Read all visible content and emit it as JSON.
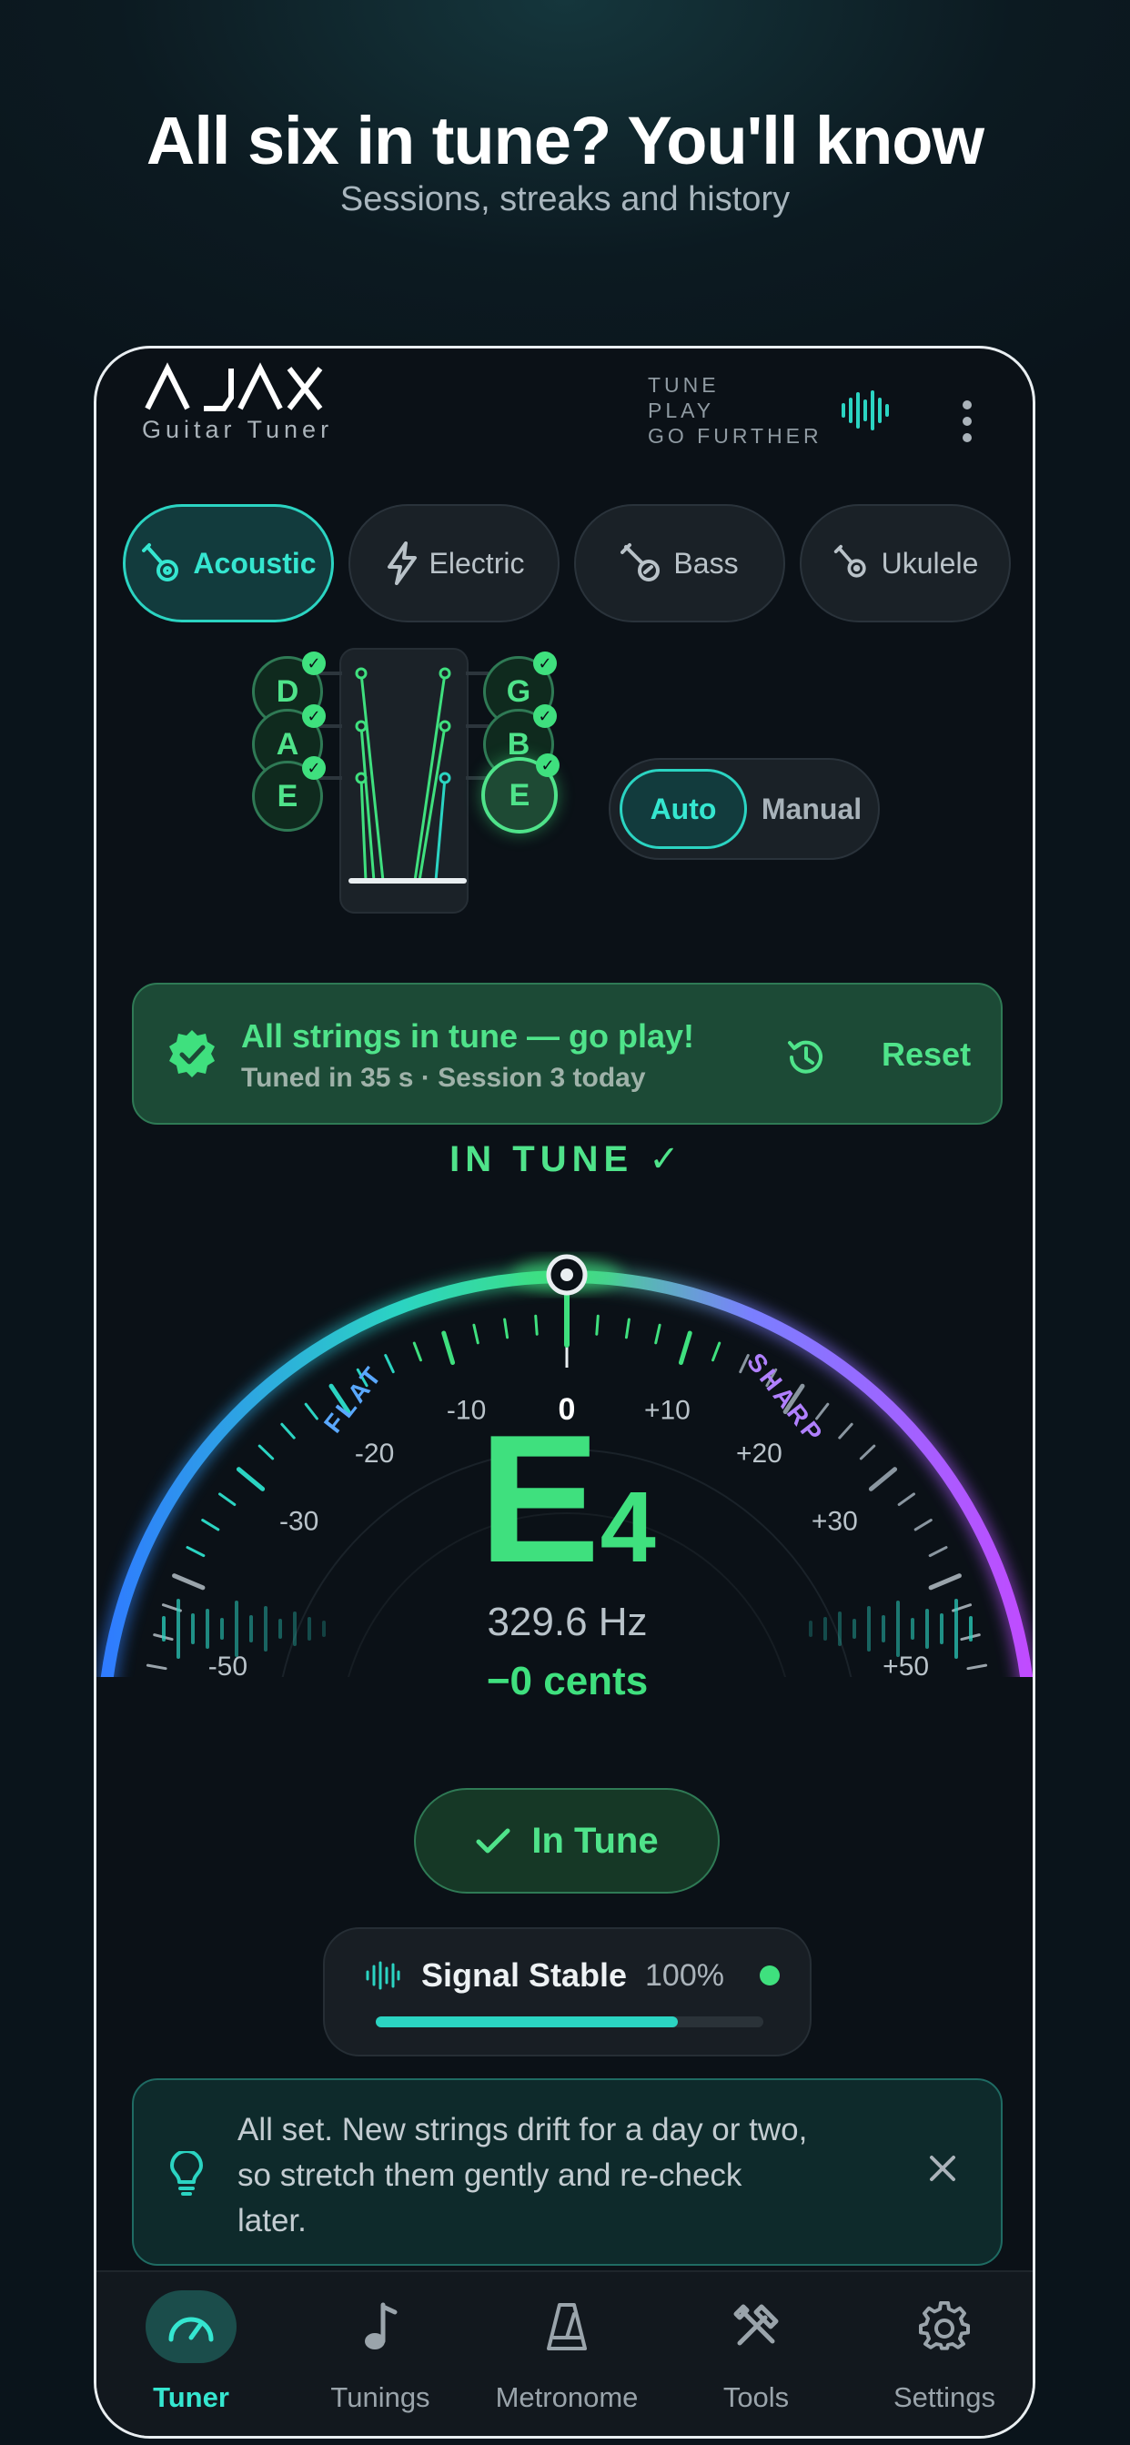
{
  "promo": {
    "headline": "All six in tune? You'll know",
    "subhead": "Sessions, streaks and history"
  },
  "header": {
    "logo_text": "AJAX",
    "logo_sub": "Guitar Tuner",
    "tagline": [
      "TUNE",
      "PLAY",
      "GO FURTHER"
    ]
  },
  "instruments": [
    {
      "label": "Acoustic",
      "icon": "acoustic-guitar-icon",
      "active": true
    },
    {
      "label": "Electric",
      "icon": "lightning-icon",
      "active": false
    },
    {
      "label": "Bass",
      "icon": "bass-guitar-icon",
      "active": false
    },
    {
      "label": "Ukulele",
      "icon": "ukulele-icon",
      "active": false
    }
  ],
  "strings": {
    "left": [
      "D",
      "A",
      "E"
    ],
    "right": [
      "G",
      "B",
      "E"
    ],
    "all_tuned": true,
    "selected": "E (high)"
  },
  "mode": {
    "auto": "Auto",
    "manual": "Manual",
    "selected": "Auto"
  },
  "banner": {
    "title": "All strings in tune — go play!",
    "subtitle": "Tuned in 35 s · Session 3 today",
    "reset": "Reset"
  },
  "gauge": {
    "status": "IN TUNE ✓",
    "flat_label": "FLAT",
    "sharp_label": "SHARP",
    "tick_labels": [
      "-50",
      "-30",
      "-20",
      "-10",
      "0",
      "+10",
      "+20",
      "+30",
      "+50"
    ],
    "cents_value": 0,
    "note": "E",
    "octave": "4",
    "frequency": "329.6 Hz",
    "cents": "−0 cents"
  },
  "in_tune_button": "In Tune",
  "signal": {
    "label": "Signal Stable",
    "percent": "100%",
    "level": 0.78
  },
  "tip": {
    "text": "All set. New strings drift for a day or two, so stretch them gently and re-check later."
  },
  "nav": [
    {
      "label": "Tuner",
      "icon": "tuner-gauge-icon",
      "active": true
    },
    {
      "label": "Tunings",
      "icon": "music-note-icon",
      "active": false
    },
    {
      "label": "Metronome",
      "icon": "metronome-icon",
      "active": false
    },
    {
      "label": "Tools",
      "icon": "tools-icon",
      "active": false
    },
    {
      "label": "Settings",
      "icon": "gear-icon",
      "active": false
    }
  ],
  "colors": {
    "accent": "#2bd4c2",
    "success": "#3fe07e",
    "flat": "#2f7bff",
    "sharp": "#b04bff"
  }
}
